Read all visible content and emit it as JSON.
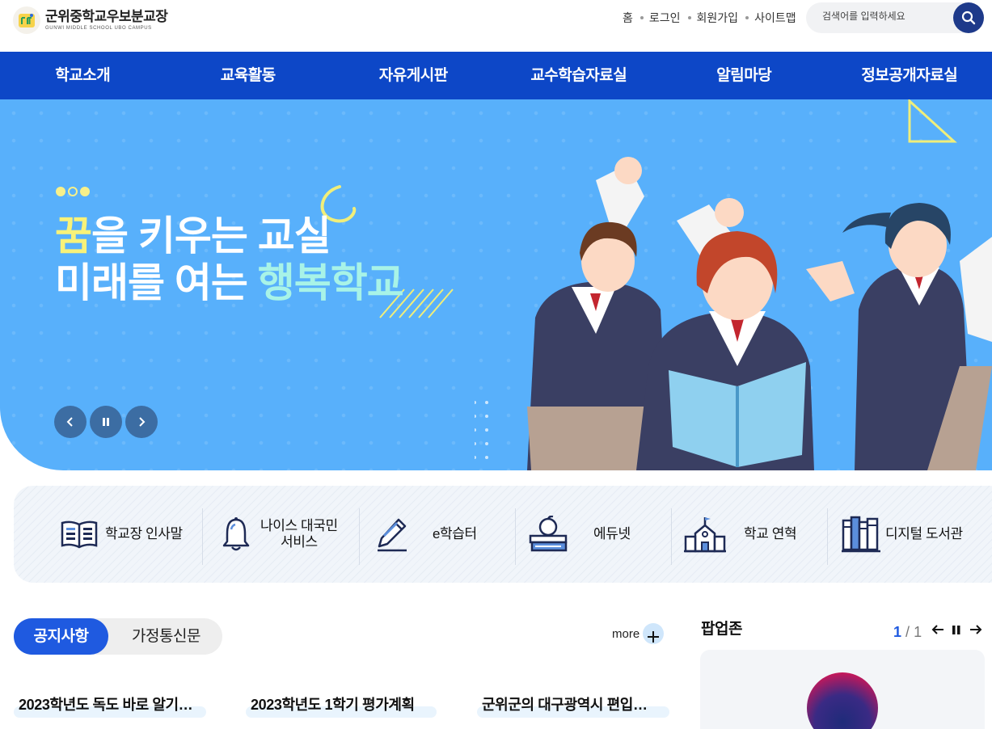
{
  "header": {
    "logo_title": "군위중학교우보분교장",
    "logo_subtitle": "GUNWI MIDDLE SCHOOL UBO CAMPUS",
    "util_links": [
      "홈",
      "로그인",
      "회원가입",
      "사이트맵"
    ],
    "search_placeholder": "검색어를 입력하세요"
  },
  "nav": {
    "items": [
      "학교소개",
      "교육활동",
      "자유게시판",
      "교수학습자료실",
      "알림마당",
      "정보공개자료실"
    ]
  },
  "hero": {
    "line1_highlight": "꿈",
    "line1_rest": "을 키우는 교실",
    "line2_rest": "미래를 여는 ",
    "line2_highlight": "행복학교",
    "slide_count": 3,
    "active_slide": 2,
    "colors": {
      "background": "#58b0fb",
      "highlight_yellow": "#f8f279",
      "highlight_mint": "#a8f3e7"
    }
  },
  "quick_links": [
    {
      "label": "학교장 인사말",
      "icon": "book-icon"
    },
    {
      "label": "나이스 대국민\n서비스",
      "label_line1": "나이스 대국민",
      "label_line2": "서비스",
      "icon": "bell-icon"
    },
    {
      "label": "e학습터",
      "icon": "pencil-icon"
    },
    {
      "label": "에듀넷",
      "icon": "apple-books-icon"
    },
    {
      "label": "학교 연혁",
      "icon": "school-building-icon"
    },
    {
      "label": "디지털 도서관",
      "icon": "bookshelf-icon"
    }
  ],
  "notice": {
    "tabs": [
      "공지사항",
      "가정통신문"
    ],
    "active_tab": "공지사항",
    "more_label": "more",
    "items": [
      "2023학년도 독도 바로 알기…",
      "2023학년도 1학기 평가계획",
      "군위군의 대구광역시 편입…"
    ]
  },
  "popup_zone": {
    "title": "팝업존",
    "current_page": "1",
    "page_sep": "/",
    "total_pages": "1"
  },
  "colors": {
    "primary": "#0d47c7",
    "accent": "#1f5ae0"
  }
}
